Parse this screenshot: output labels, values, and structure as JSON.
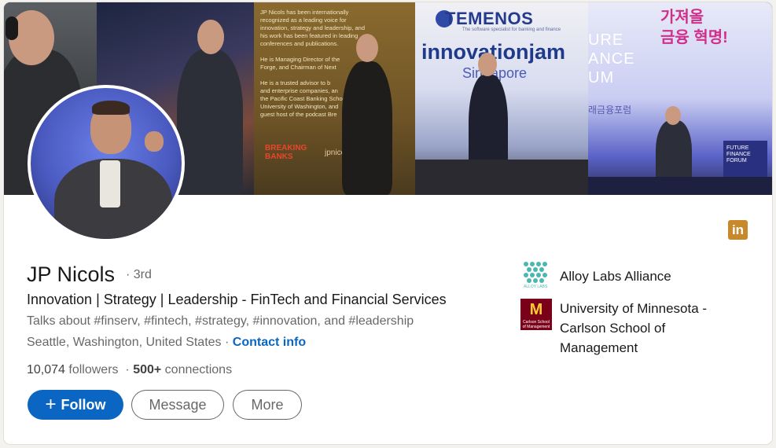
{
  "banner": {
    "panel3_text": "JP Nicols has been internationally\nrecognized as a leading voice for\ninnovation, strategy and leadership, and\nhis work has been featured in leading\nconferences and publications.\n\nHe is Managing Director of the\nForge, and Chairman of Next\n\nHe is a trusted advisor to b\nand enterprise companies, an\nthe Pacific Coast Banking Schoo\nUniversity of Washington, and\nguest host of the podcast Bre",
    "panel3_logo": "BREAKING\nBANKS",
    "panel3_logo2": "jpnico",
    "temenos": "TEMENOS",
    "temenos_sub": "The software specialist for banking and finance",
    "innovationjam": "innovationjam",
    "singapore": "Singapore",
    "korean_title": "가져올\n금융 혁명!",
    "forum_big": "URE\nANCE\nUM",
    "korean_small": "래금융포럼",
    "forum_logo": "FUTURE\nFINANCE\nFORUM"
  },
  "profile": {
    "name": "JP Nicols",
    "degree": "· 3rd",
    "headline": "Innovation | Strategy | Leadership - FinTech and Financial Services",
    "talks_about": "Talks about #finserv, #fintech, #strategy, #innovation, and #leadership",
    "location": "Seattle, Washington, United States",
    "separator": " · ",
    "contact_info": "Contact info",
    "followers_count": "10,074",
    "followers_label": " followers",
    "connections_prefix": "· ",
    "connections_count": "500+",
    "connections_label": " connections"
  },
  "linkedin_badge": "in",
  "actions": {
    "follow_label": "Follow",
    "message_label": "Message",
    "more_label": "More"
  },
  "organizations": [
    {
      "name": "Alloy Labs Alliance",
      "logo_text": "ALLOY LABS"
    },
    {
      "name": "University of Minnesota - Carlson School of Management",
      "logo_text": "Carlson School of Management"
    }
  ],
  "colors": {
    "primary": "#0a66c2",
    "linkedin_badge": "#c7892a",
    "umn_maroon": "#7a0019",
    "umn_gold": "#ffcc33"
  }
}
